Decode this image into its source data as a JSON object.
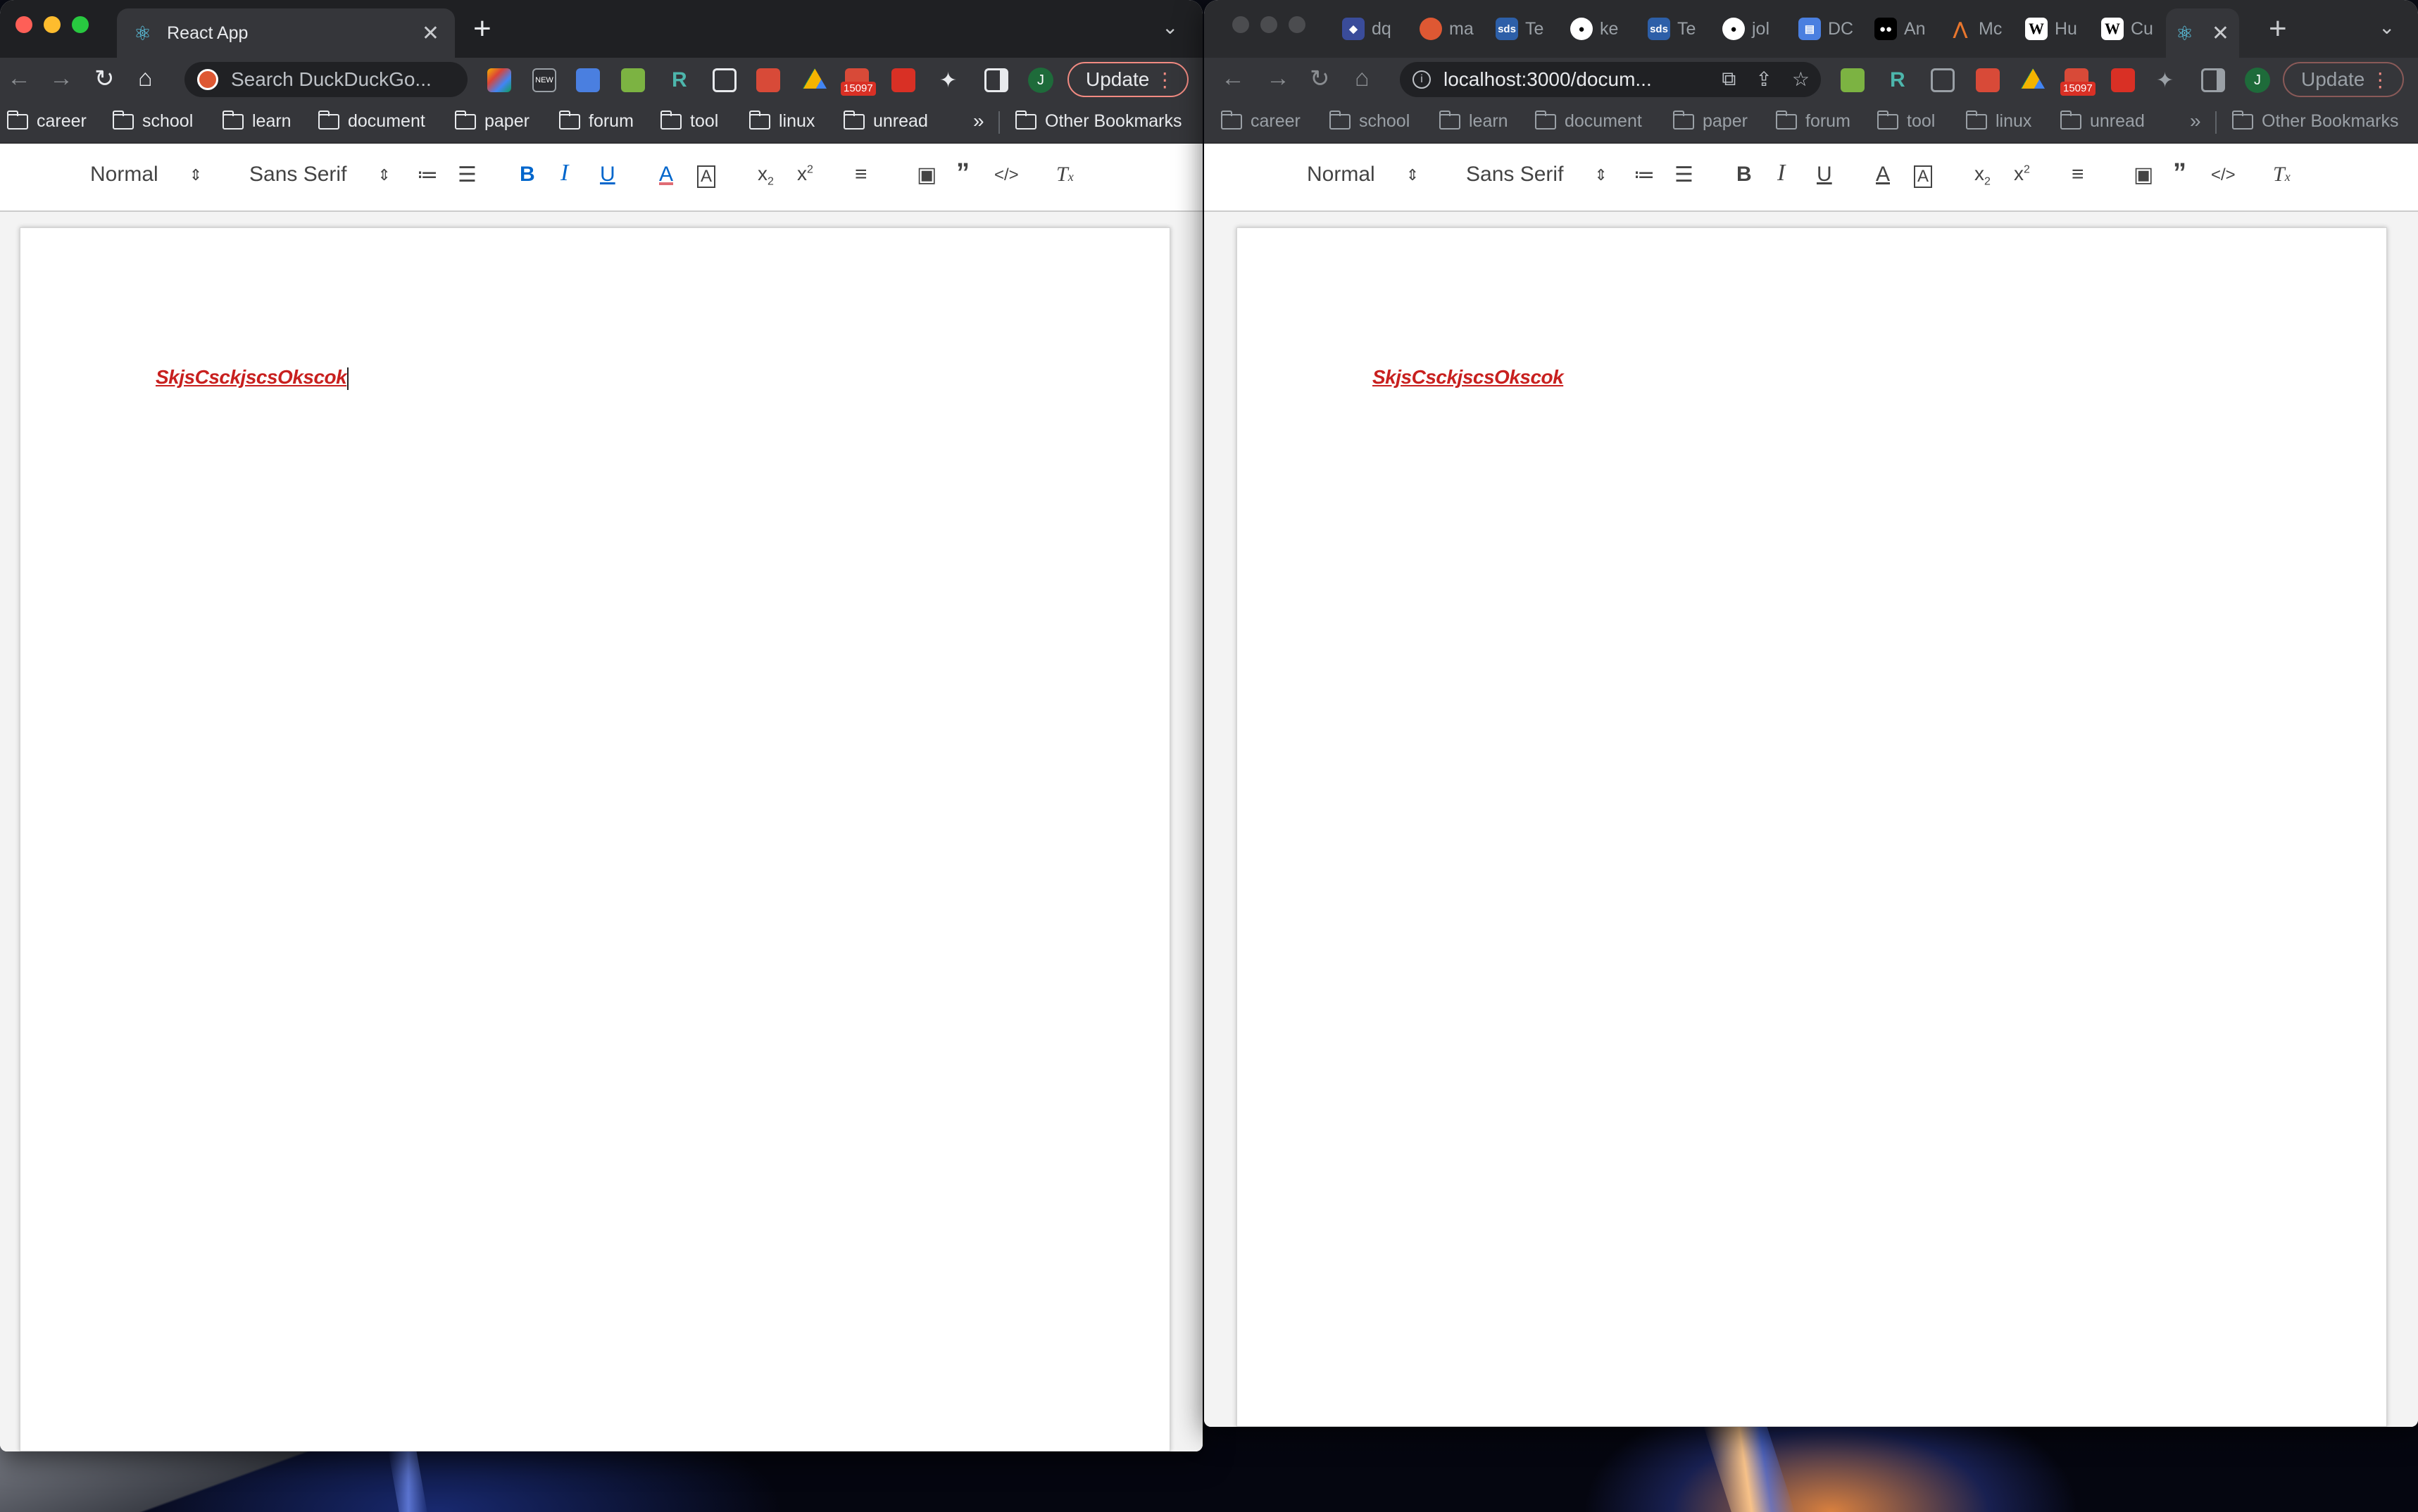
{
  "left_window": {
    "tab_title": "React App",
    "omnibox_placeholder": "Search DuckDuckGo...",
    "extension_badge": "15097",
    "avatar_letter": "J",
    "update_label": "Update",
    "bookmarks": [
      "career",
      "school",
      "learn",
      "document",
      "paper",
      "forum",
      "tool",
      "linux",
      "unread"
    ],
    "bookmarks_more": "»",
    "other_bookmarks": "Other Bookmarks",
    "editor": {
      "header_select": "Normal",
      "font_select": "Sans Serif",
      "document_text": "SkjsCsckjscsOkscok"
    }
  },
  "right_window": {
    "tabs": [
      {
        "title": "dq",
        "icon": "scale-icon",
        "color": "#6b8cff"
      },
      {
        "title": "ma",
        "icon": "ddg-icon",
        "color": "#de5833"
      },
      {
        "title": "Te",
        "icon": "sds-icon",
        "color": "#2d5fa8"
      },
      {
        "title": "ke",
        "icon": "github-icon",
        "color": "#ffffff"
      },
      {
        "title": "Te",
        "icon": "sds-icon",
        "color": "#2d5fa8"
      },
      {
        "title": "jol",
        "icon": "github-icon",
        "color": "#ffffff"
      },
      {
        "title": "DC",
        "icon": "doc-icon",
        "color": "#4a7fe0"
      },
      {
        "title": "An",
        "icon": "medium-icon",
        "color": "#ffffff"
      },
      {
        "title": "Mc",
        "icon": "matlab-icon",
        "color": "#e8762d"
      },
      {
        "title": "Hu",
        "icon": "wikipedia-icon",
        "color": "#ffffff"
      },
      {
        "title": "Cu",
        "icon": "wikipedia-icon",
        "color": "#ffffff"
      }
    ],
    "url": "localhost:3000/docum...",
    "extension_badge": "15097",
    "avatar_letter": "J",
    "update_label": "Update",
    "bookmarks": [
      "career",
      "school",
      "learn",
      "document",
      "paper",
      "forum",
      "tool",
      "linux",
      "unread"
    ],
    "bookmarks_more": "»",
    "other_bookmarks": "Other Bookmarks",
    "editor": {
      "header_select": "Normal",
      "font_select": "Sans Serif",
      "document_text": "SkjsCsckjscsOkscok"
    }
  },
  "colors": {
    "document_text": "#c8201f",
    "active_format": "#0066cc",
    "update_border": "#f28b82"
  }
}
